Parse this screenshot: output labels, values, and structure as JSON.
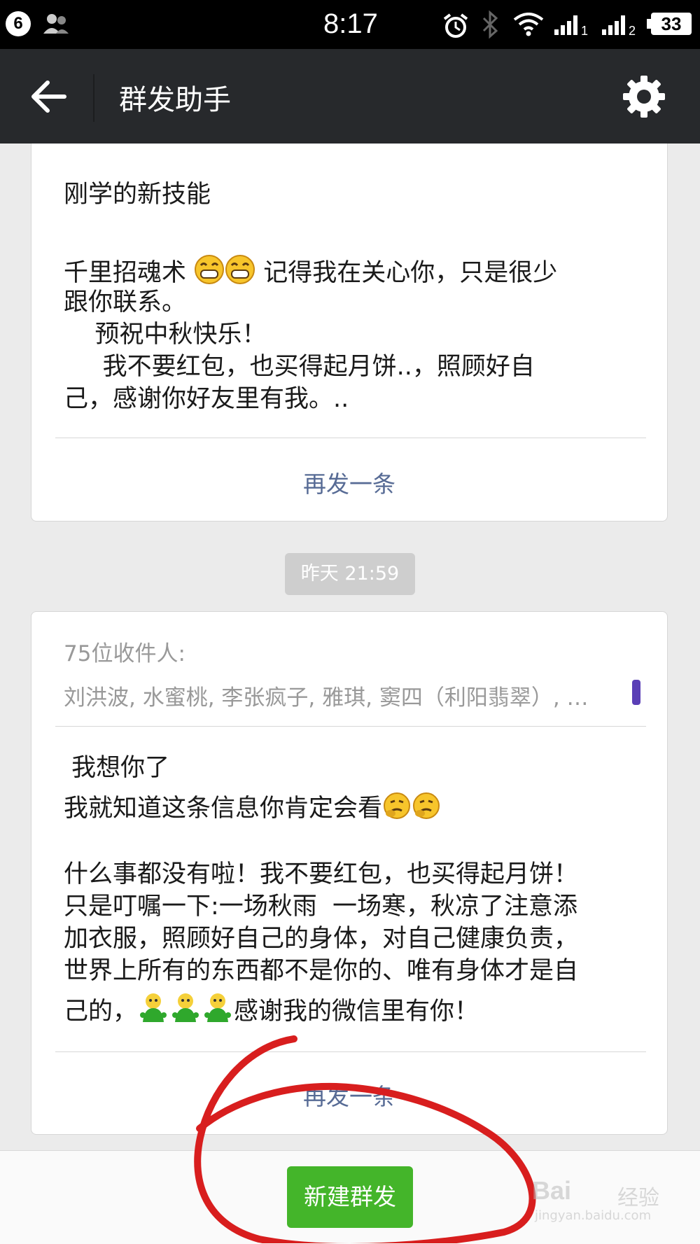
{
  "status_bar": {
    "notification_count": "6",
    "time": "8:17",
    "signal_1_badge": "1",
    "signal_2_badge": "2",
    "battery": "33"
  },
  "nav": {
    "title": "群发助手",
    "icons": [
      "back-arrow-icon",
      "gear-icon"
    ]
  },
  "messages": [
    {
      "text_lines": [
        "刚学的新技能",
        "",
        "千里招魂术 ",
        " 记得我在关心你，只是很少",
        "跟你联系。",
        "    预祝中秋快乐！",
        "     我不要红包，也买得起月饼..，照顾好自",
        "己，感谢你好友里有我。.."
      ],
      "emoji": [
        "grin-emoji",
        "grin-emoji"
      ],
      "resend_label": "再发一条"
    },
    {
      "timestamp": "昨天 21:59",
      "recipient_count_label": "75位收件人:",
      "recipients": "刘洪波, 水蜜桃, 李张疯子, 雅琪, 窦四（利阳翡翠）, …",
      "text_lines": [
        " 我想你了",
        "我就知道这条信息你肯定会看",
        "",
        "什么事都没有啦！我不要红包，也买得起月饼！",
        "只是叮嘱一下:一场秋雨  一场寒，秋凉了注意添",
        "加衣服，照顾好自己的身体，对自己健康负责，",
        "世界上所有的东西都不是你的、唯有身体才是自",
        "己的，",
        "感谢我的微信里有你！"
      ],
      "emoji_inline_1": [
        "thinking-emoji",
        "thinking-emoji"
      ],
      "emoji_inline_2": [
        "green-person-emoji",
        "green-person-emoji",
        "green-person-emoji"
      ],
      "resend_label": "再发一条"
    }
  ],
  "bottom": {
    "new_broadcast_label": "新建群发"
  },
  "watermark": {
    "brand": "Bai",
    "brand2": "经验",
    "url": "jingyan.baidu.com"
  },
  "colors": {
    "nav_bg": "#27292c",
    "link": "#576b95",
    "primary_button": "#44b52a",
    "annotation": "#d81e1e"
  }
}
